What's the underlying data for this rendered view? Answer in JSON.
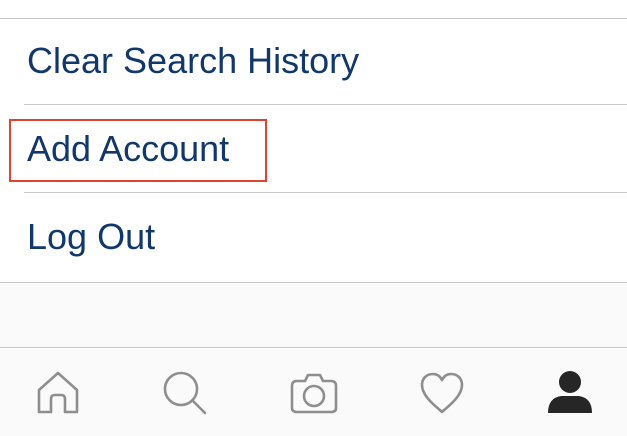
{
  "menu": {
    "items": [
      {
        "label": "Clear Search History"
      },
      {
        "label": "Add Account"
      },
      {
        "label": "Log Out"
      }
    ],
    "text_color": "#12376a",
    "highlight_color": "#e0432f"
  },
  "tabbar": {
    "tabs": [
      {
        "icon": "home-icon"
      },
      {
        "icon": "search-icon"
      },
      {
        "icon": "camera-icon"
      },
      {
        "icon": "heart-icon"
      },
      {
        "icon": "profile-icon"
      }
    ],
    "active_tab": "profile",
    "icon_color": "#8e8e8e",
    "active_icon_color": "#262626"
  }
}
